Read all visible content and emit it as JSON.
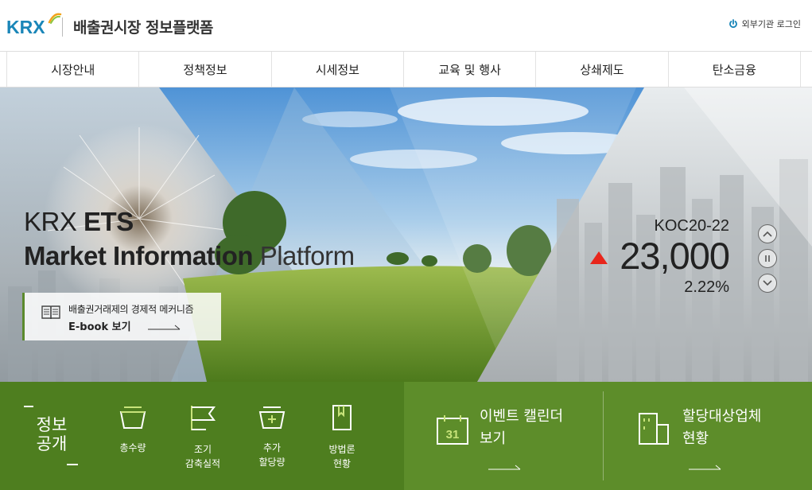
{
  "header": {
    "logo_text": "KRX",
    "site_title": "배출권시장 정보플랫폼",
    "login_label": "외부기관 로그인",
    "login_icon": "power-icon",
    "brand_color": "#1a86b8"
  },
  "nav": {
    "items": [
      "시장안내",
      "정책정보",
      "시세정보",
      "교육 및 행사",
      "상쇄제도",
      "탄소금융"
    ]
  },
  "hero": {
    "title_line1_normal": "KRX ",
    "title_line1_bold": "ETS",
    "title_line2_bold": "Market Information",
    "title_line2_normal": " Platform",
    "ebook": {
      "line1": "배출권거래제의 경제적 메커니즘",
      "line2": "E-book 보기",
      "icon": "book-icon"
    },
    "ticker": {
      "name": "KOC20-22",
      "price": "23,000",
      "change_pct": "2.22%",
      "direction": "up",
      "up_color": "#e8261c"
    },
    "controls": [
      "chevron-up-icon",
      "pause-icon",
      "chevron-down-icon"
    ]
  },
  "bottom": {
    "info_title": "정보\n공개",
    "quick_links": [
      {
        "label": "총수량",
        "icon": "basket-icon"
      },
      {
        "label": "조기\n감축실적",
        "icon": "flag-icon"
      },
      {
        "label": "추가\n할당량",
        "icon": "basket-plus-icon"
      },
      {
        "label": "방법론\n현황",
        "icon": "bookmark-icon"
      }
    ],
    "features": [
      {
        "line1": "이벤트 캘린더",
        "line2": "보기",
        "icon": "calendar-icon",
        "calendar_day": "31"
      },
      {
        "line1": "할당대상업체",
        "line2": "현황",
        "icon": "building-icon"
      }
    ],
    "left_color": "#4e7e1f",
    "right_color": "#5d8d2a"
  }
}
